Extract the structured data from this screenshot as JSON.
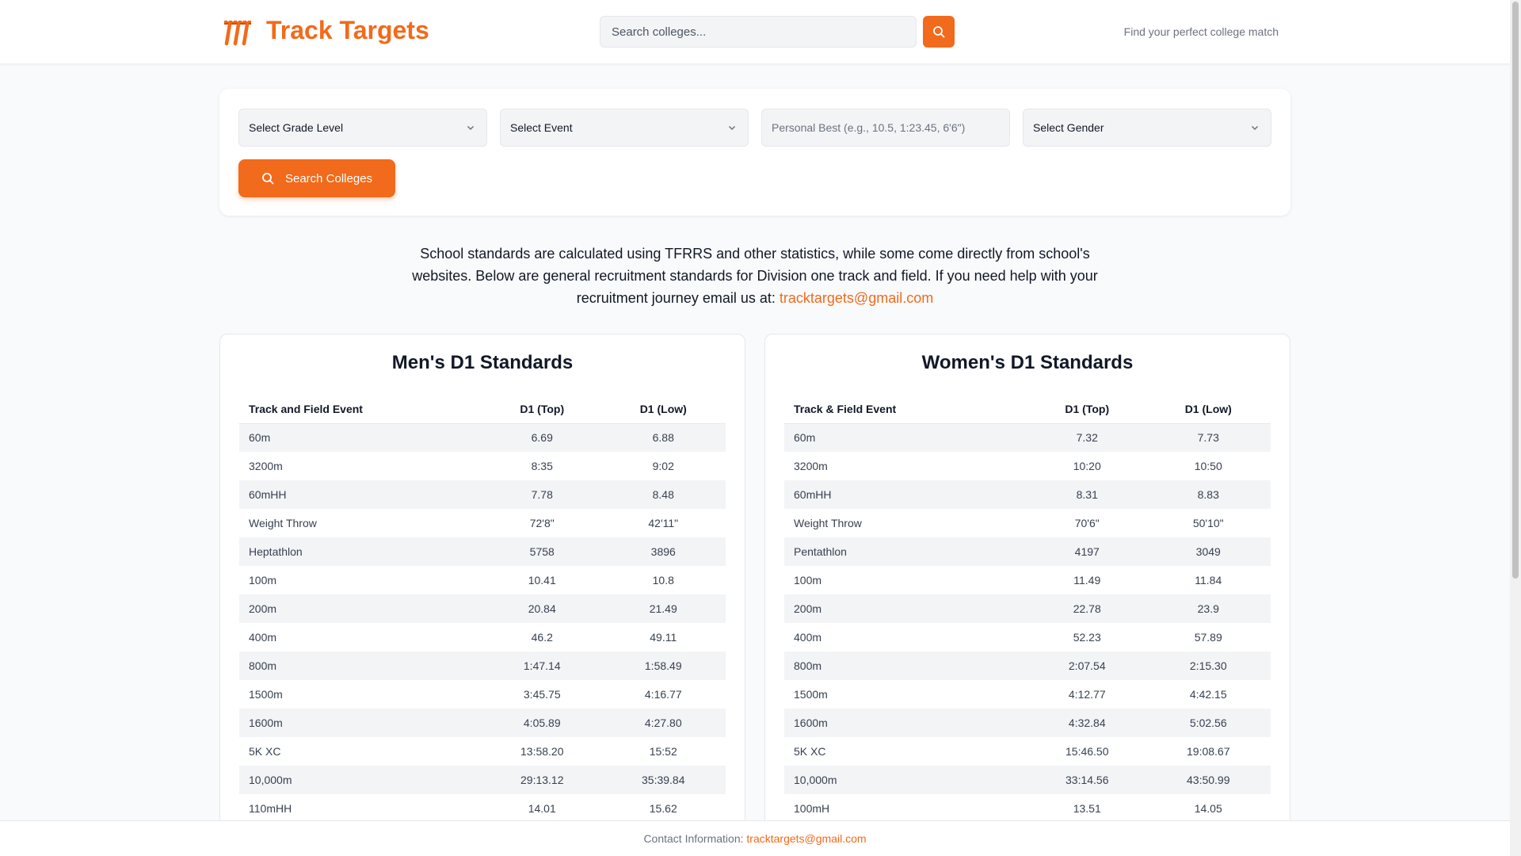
{
  "header": {
    "brand": "Track Targets",
    "search_placeholder": "Search colleges...",
    "tagline": "Find your perfect college match"
  },
  "filters": {
    "grade_level": "Select Grade Level",
    "event": "Select Event",
    "personal_best_placeholder": "Personal Best (e.g., 10.5, 1:23.45, 6'6\")",
    "gender": "Select Gender",
    "search_button": "Search Colleges"
  },
  "intro": {
    "text": "School standards are calculated using TFRRS and other statistics, while some come directly from school's websites. Below are general recruitment standards for Division one track and field. If you need help with your recruitment journey email us at:",
    "email": "tracktargets@gmail.com"
  },
  "men": {
    "title": "Men's D1 Standards",
    "headers": [
      "Track and Field Event",
      "D1 (Top)",
      "D1 (Low)"
    ],
    "rows": [
      [
        "60m",
        "6.69",
        "6.88"
      ],
      [
        "3200m",
        "8:35",
        "9:02"
      ],
      [
        "60mHH",
        "7.78",
        "8.48"
      ],
      [
        "Weight Throw",
        "72'8\"",
        "42'11\""
      ],
      [
        "Heptathlon",
        "5758",
        "3896"
      ],
      [
        "100m",
        "10.41",
        "10.8"
      ],
      [
        "200m",
        "20.84",
        "21.49"
      ],
      [
        "400m",
        "46.2",
        "49.11"
      ],
      [
        "800m",
        "1:47.14",
        "1:58.49"
      ],
      [
        "1500m",
        "3:45.75",
        "4:16.77"
      ],
      [
        "1600m",
        "4:05.89",
        "4:27.80"
      ],
      [
        "5K XC",
        "13:58.20",
        "15:52"
      ],
      [
        "10,000m",
        "29:13.12",
        "35:39.84"
      ],
      [
        "110mHH",
        "14.01",
        "15.62"
      ]
    ]
  },
  "women": {
    "title": "Women's D1 Standards",
    "headers": [
      "Track & Field Event",
      "D1 (Top)",
      "D1 (Low)"
    ],
    "rows": [
      [
        "60m",
        "7.32",
        "7.73"
      ],
      [
        "3200m",
        "10:20",
        "10:50"
      ],
      [
        "60mHH",
        "8.31",
        "8.83"
      ],
      [
        "Weight Throw",
        "70'6\"",
        "50'10\""
      ],
      [
        "Pentathlon",
        "4197",
        "3049"
      ],
      [
        "100m",
        "11.49",
        "11.84"
      ],
      [
        "200m",
        "22.78",
        "23.9"
      ],
      [
        "400m",
        "52.23",
        "57.89"
      ],
      [
        "800m",
        "2:07.54",
        "2:15.30"
      ],
      [
        "1500m",
        "4:12.77",
        "4:42.15"
      ],
      [
        "1600m",
        "4:32.84",
        "5:02.56"
      ],
      [
        "5K XC",
        "15:46.50",
        "19:08.67"
      ],
      [
        "10,000m",
        "33:14.56",
        "43:50.99"
      ],
      [
        "100mH",
        "13.51",
        "14.05"
      ]
    ]
  },
  "footer": {
    "label": "Contact Information:",
    "email": "tracktargets@gmail.com"
  },
  "colors": {
    "accent": "#f26a1b"
  },
  "icons": {
    "logo": "hurdles-logo-icon",
    "search": "search-icon",
    "dropdown": "chevron-down-icon"
  }
}
